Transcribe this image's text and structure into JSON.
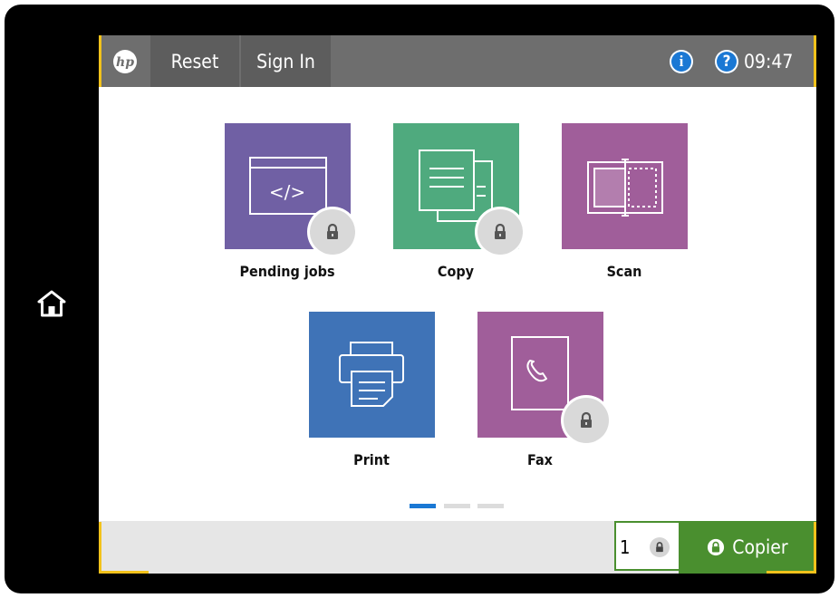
{
  "topbar": {
    "reset_label": "Reset",
    "sign_in_label": "Sign In",
    "info_glyph": "i",
    "help_glyph": "?",
    "time": "09:47"
  },
  "tiles": [
    {
      "label": "Pending jobs",
      "color": "#7060a4",
      "icon": "code-window-icon",
      "locked": true
    },
    {
      "label": "Copy",
      "color": "#4faa7e",
      "icon": "copy-documents-icon",
      "locked": true
    },
    {
      "label": "Scan",
      "color": "#a05e9a",
      "icon": "scan-icon",
      "locked": false
    },
    {
      "label": "Print",
      "color": "#3f73b7",
      "icon": "printer-icon",
      "locked": false
    },
    {
      "label": "Fax",
      "color": "#a05e9a",
      "icon": "fax-phone-icon",
      "locked": true
    }
  ],
  "pagination": {
    "current": 1,
    "total": 3,
    "active_color": "#1a78d4"
  },
  "bottombar": {
    "copies": "1",
    "copier_label": "Copier",
    "copier_color": "#4a8f2f"
  },
  "accent_color": "#f2c21b"
}
